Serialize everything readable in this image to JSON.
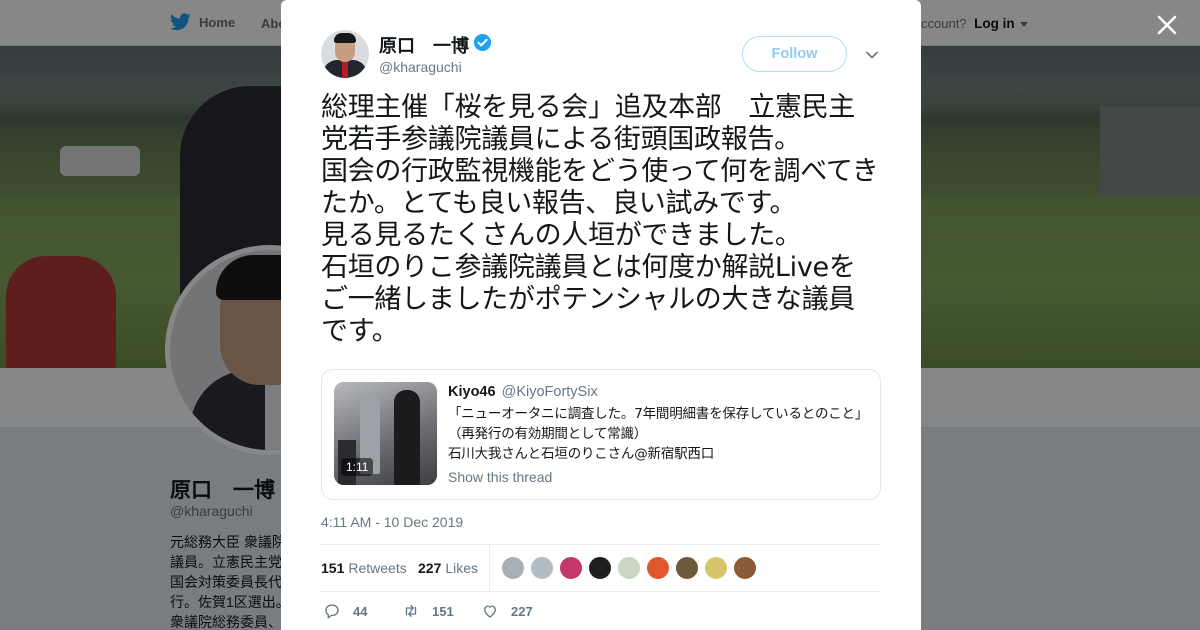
{
  "topnav": {
    "home_label": "Home",
    "about_label": "Abo",
    "account_prompt": "ccount?",
    "login_label": "Log in"
  },
  "profile": {
    "name": "原口　一博",
    "handle": "@kharaguchi",
    "bio": "元総務大臣 衆議院議員。立憲民主党国会対策委員長代行。佐賀1区選出。衆議院総務委員、予算委員会理事等を歴任。国民を守るために行動"
  },
  "tweet": {
    "author_name": "原口　一博",
    "author_handle": "@kharaguchi",
    "follow_label": "Follow",
    "text": "総理主催「桜を見る会」追及本部　立憲民主党若手参議院議員による街頭国政報告。\n国会の行政監視機能をどう使って何を調べてきたか。とても良い報告、良い試みです。\n見る見るたくさんの人垣ができました。\n石垣のりこ参議院議員とは何度か解説Liveをご一緒しましたがポテンシャルの大きな議員です。",
    "timestamp": "4:11 AM - 10 Dec 2019",
    "retweets_count": "151",
    "retweets_label": "Retweets",
    "likes_count": "227",
    "likes_label": "Likes",
    "reply_count": "44",
    "retweet_action_count": "151",
    "like_action_count": "227"
  },
  "quote": {
    "author_name": "Kiyo46",
    "author_handle": "@KiyoFortySix",
    "text": "「ニューオータニに調査した。7年間明細書を保存しているとのこと」（再発行の有効期間として常識）\n石川大我さんと石垣のりこさん@新宿駅西口",
    "video_duration": "1:11",
    "show_thread_label": "Show this thread"
  },
  "likers": [
    {
      "color": "#a7b0b8"
    },
    {
      "color": "#b3bcc4"
    },
    {
      "color": "#c4356a"
    },
    {
      "color": "#1e1e1e"
    },
    {
      "color": "#c9d6c2"
    },
    {
      "color": "#e0572e"
    },
    {
      "color": "#6b5a3c"
    },
    {
      "color": "#d8c46a"
    },
    {
      "color": "#8a5a3a"
    }
  ],
  "colors": {
    "twitter_blue": "#1da1f2",
    "text_primary": "#14171a",
    "text_secondary": "#657786"
  },
  "icons": {
    "bird": "twitter-bird-icon",
    "verified": "verified-badge-icon",
    "close": "close-icon",
    "caret": "chevron-down-icon",
    "reply": "reply-icon",
    "retweet": "retweet-icon",
    "like": "heart-icon"
  }
}
